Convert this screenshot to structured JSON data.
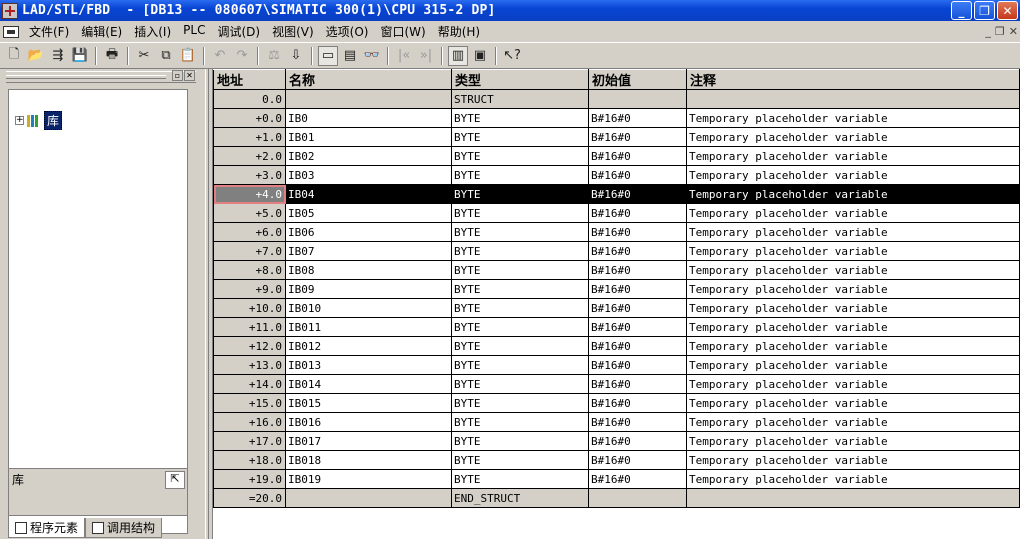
{
  "window": {
    "title": "LAD/STL/FBD  - [DB13 -- 080607\\SIMATIC 300(1)\\CPU 315-2 DP]",
    "minimize": "_",
    "maximize": "❐",
    "close": "✕"
  },
  "menu": {
    "items": [
      "文件(F)",
      "编辑(E)",
      "插入(I)",
      "PLC",
      "调试(D)",
      "视图(V)",
      "选项(O)",
      "窗口(W)",
      "帮助(H)"
    ],
    "mdi_min": "_",
    "mdi_restore": "❐",
    "mdi_close": "✕"
  },
  "sidebar": {
    "tree_root_label": "库",
    "info_label": "库",
    "tabs": [
      "程序元素",
      "调用结构"
    ]
  },
  "table": {
    "headers": [
      "地址",
      "名称",
      "类型",
      "初始值",
      "注释"
    ],
    "selected_index": 5,
    "rows": [
      {
        "addr": "0.0",
        "name": "",
        "type": "STRUCT",
        "init": "",
        "comment": "",
        "struct": true
      },
      {
        "addr": "+0.0",
        "name": "IB0",
        "type": "BYTE",
        "init": "B#16#0",
        "comment": "Temporary placeholder variable"
      },
      {
        "addr": "+1.0",
        "name": "IB01",
        "type": "BYTE",
        "init": "B#16#0",
        "comment": "Temporary placeholder variable"
      },
      {
        "addr": "+2.0",
        "name": "IB02",
        "type": "BYTE",
        "init": "B#16#0",
        "comment": "Temporary placeholder variable"
      },
      {
        "addr": "+3.0",
        "name": "IB03",
        "type": "BYTE",
        "init": "B#16#0",
        "comment": "Temporary placeholder variable"
      },
      {
        "addr": "+4.0",
        "name": "IB04",
        "type": "BYTE",
        "init": "B#16#0",
        "comment": "Temporary placeholder variable"
      },
      {
        "addr": "+5.0",
        "name": "IB05",
        "type": "BYTE",
        "init": "B#16#0",
        "comment": "Temporary placeholder variable"
      },
      {
        "addr": "+6.0",
        "name": "IB06",
        "type": "BYTE",
        "init": "B#16#0",
        "comment": "Temporary placeholder variable"
      },
      {
        "addr": "+7.0",
        "name": "IB07",
        "type": "BYTE",
        "init": "B#16#0",
        "comment": "Temporary placeholder variable"
      },
      {
        "addr": "+8.0",
        "name": "IB08",
        "type": "BYTE",
        "init": "B#16#0",
        "comment": "Temporary placeholder variable"
      },
      {
        "addr": "+9.0",
        "name": "IB09",
        "type": "BYTE",
        "init": "B#16#0",
        "comment": "Temporary placeholder variable"
      },
      {
        "addr": "+10.0",
        "name": "IB010",
        "type": "BYTE",
        "init": "B#16#0",
        "comment": "Temporary placeholder variable"
      },
      {
        "addr": "+11.0",
        "name": "IB011",
        "type": "BYTE",
        "init": "B#16#0",
        "comment": "Temporary placeholder variable"
      },
      {
        "addr": "+12.0",
        "name": "IB012",
        "type": "BYTE",
        "init": "B#16#0",
        "comment": "Temporary placeholder variable"
      },
      {
        "addr": "+13.0",
        "name": "IB013",
        "type": "BYTE",
        "init": "B#16#0",
        "comment": "Temporary placeholder variable"
      },
      {
        "addr": "+14.0",
        "name": "IB014",
        "type": "BYTE",
        "init": "B#16#0",
        "comment": "Temporary placeholder variable"
      },
      {
        "addr": "+15.0",
        "name": "IB015",
        "type": "BYTE",
        "init": "B#16#0",
        "comment": "Temporary placeholder variable"
      },
      {
        "addr": "+16.0",
        "name": "IB016",
        "type": "BYTE",
        "init": "B#16#0",
        "comment": "Temporary placeholder variable"
      },
      {
        "addr": "+17.0",
        "name": "IB017",
        "type": "BYTE",
        "init": "B#16#0",
        "comment": "Temporary placeholder variable"
      },
      {
        "addr": "+18.0",
        "name": "IB018",
        "type": "BYTE",
        "init": "B#16#0",
        "comment": "Temporary placeholder variable"
      },
      {
        "addr": "+19.0",
        "name": "IB019",
        "type": "BYTE",
        "init": "B#16#0",
        "comment": "Temporary placeholder variable"
      },
      {
        "addr": "=20.0",
        "name": "",
        "type": "END_STRUCT",
        "init": "",
        "comment": "",
        "struct": true
      }
    ]
  },
  "toolbar": {
    "buttons": [
      {
        "icon": "new-icon",
        "glyph": "🗋"
      },
      {
        "icon": "open-icon",
        "glyph": "📂"
      },
      {
        "icon": "network-icon",
        "glyph": "⇶"
      },
      {
        "icon": "save-icon",
        "glyph": "💾"
      },
      {
        "sep": true
      },
      {
        "icon": "print-icon",
        "glyph": "🖶"
      },
      {
        "sep": true
      },
      {
        "icon": "cut-icon",
        "glyph": "✂"
      },
      {
        "icon": "copy-icon",
        "glyph": "⧉"
      },
      {
        "icon": "paste-icon",
        "glyph": "📋"
      },
      {
        "sep": true
      },
      {
        "icon": "undo-icon",
        "glyph": "↶",
        "dim": true
      },
      {
        "icon": "redo-icon",
        "glyph": "↷",
        "dim": true
      },
      {
        "sep": true
      },
      {
        "icon": "compare-icon",
        "glyph": "⚖",
        "dim": true
      },
      {
        "icon": "download-icon",
        "glyph": "⇩"
      },
      {
        "sep": true
      },
      {
        "icon": "declaration-view-icon",
        "glyph": "▭",
        "pressed": true
      },
      {
        "icon": "module-icon",
        "glyph": "▤"
      },
      {
        "icon": "monitor-icon",
        "glyph": "👓"
      },
      {
        "sep": true
      },
      {
        "icon": "prev-icon",
        "glyph": "|«",
        "dim": true
      },
      {
        "icon": "next-icon",
        "glyph": "»|",
        "dim": true
      },
      {
        "sep": true
      },
      {
        "icon": "overview-icon",
        "glyph": "▥",
        "pressed": true
      },
      {
        "icon": "details-icon",
        "glyph": "▣"
      },
      {
        "sep": true
      },
      {
        "icon": "help-icon",
        "glyph": "↖?"
      }
    ]
  }
}
